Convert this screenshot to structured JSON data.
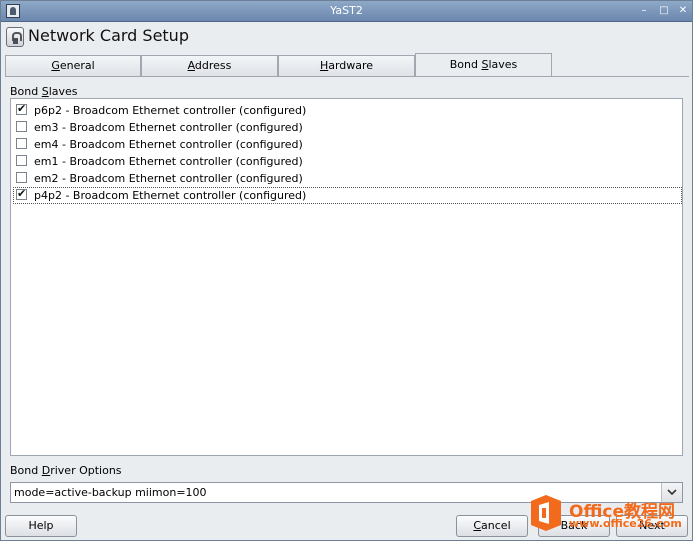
{
  "window": {
    "title": "YaST2",
    "minimize_glyph": "–",
    "maximize_glyph": "□",
    "close_glyph": "✕"
  },
  "header": {
    "title": "Network Card Setup"
  },
  "tabs": [
    {
      "label": "General",
      "mnemonic": "G",
      "rest": "eneral",
      "active": false
    },
    {
      "label": "Address",
      "mnemonic": "A",
      "rest": "ddress",
      "active": false
    },
    {
      "label": "Hardware",
      "mnemonic": "H",
      "rest": "ardware",
      "active": false
    },
    {
      "label": "Bond Slaves",
      "prefix": "Bond ",
      "mnemonic": "S",
      "rest": "laves",
      "active": true
    }
  ],
  "bond_slaves": {
    "label_prefix": "Bond ",
    "label_mnemonic": "S",
    "label_rest": "laves",
    "items": [
      {
        "label": "p6p2 - Broadcom Ethernet controller (configured)",
        "checked": true
      },
      {
        "label": "em3 - Broadcom Ethernet controller (configured)",
        "checked": false
      },
      {
        "label": "em4 - Broadcom Ethernet controller (configured)",
        "checked": false
      },
      {
        "label": "em1 - Broadcom Ethernet controller (configured)",
        "checked": false
      },
      {
        "label": "em2 - Broadcom Ethernet controller (configured)",
        "checked": false
      },
      {
        "label": "p4p2 - Broadcom Ethernet controller (configured)",
        "checked": true
      }
    ]
  },
  "driver_options": {
    "label_prefix": "Bond ",
    "label_mnemonic": "D",
    "label_rest": "river Options",
    "value": "mode=active-backup miimon=100"
  },
  "buttons": {
    "help": "Help",
    "cancel_mnemonic": "C",
    "cancel_rest": "ancel",
    "back": "Back",
    "next": "Next"
  },
  "watermark": {
    "brand": "Office教程网",
    "url": "www.office26.com"
  }
}
